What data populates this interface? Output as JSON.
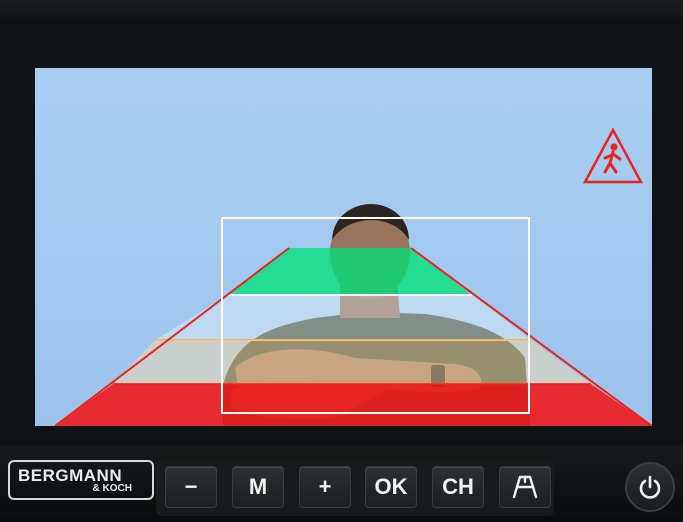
{
  "brand": {
    "line1": "BERGMANN",
    "line2": "& KOCH"
  },
  "buttons": [
    {
      "id": "minus",
      "label": "−"
    },
    {
      "id": "mode",
      "label": "M"
    },
    {
      "id": "plus",
      "label": "+"
    },
    {
      "id": "ok",
      "label": "OK"
    },
    {
      "id": "channel",
      "label": "CH"
    },
    {
      "id": "guide",
      "label": "",
      "icon": "parking-guide-icon"
    }
  ],
  "power_icon": "power-icon",
  "warning_icon": "pedestrian-warning-icon",
  "colors": {
    "zone_green": "#00e27a",
    "zone_yellow": "#f4d9a8",
    "zone_red": "#ee1c1c",
    "guide_line": "#e8241e",
    "warning": "#e8241e"
  }
}
